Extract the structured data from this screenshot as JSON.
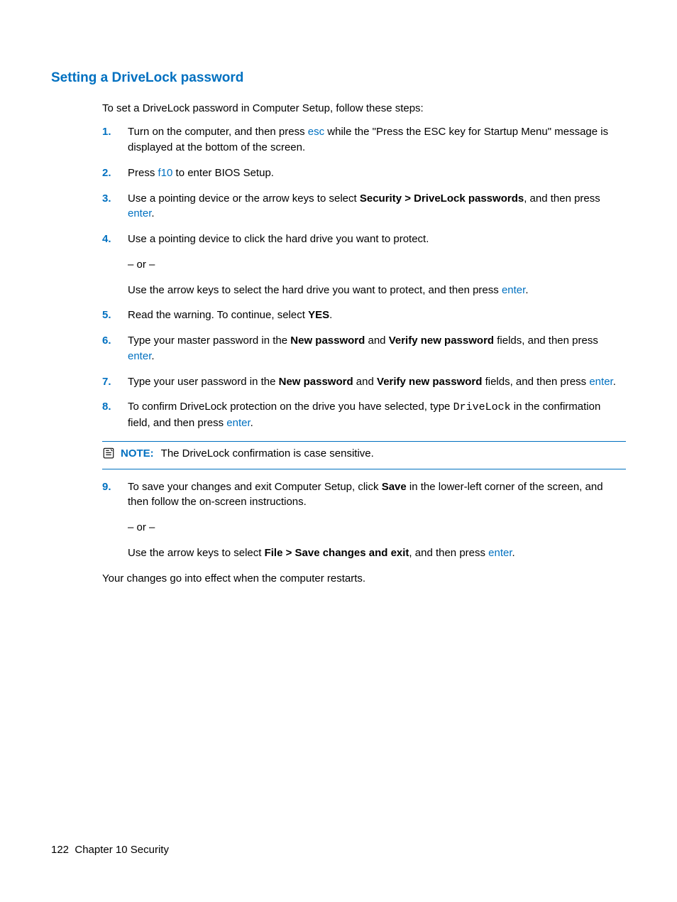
{
  "heading": "Setting a DriveLock password",
  "intro": "To set a DriveLock password in Computer Setup, follow these steps:",
  "steps": {
    "s1": {
      "num": "1.",
      "a": "Turn on the computer, and then press ",
      "key": "esc",
      "b": " while the \"Press the ESC key for Startup Menu\" message is displayed at the bottom of the screen."
    },
    "s2": {
      "num": "2.",
      "a": "Press ",
      "key": "f10",
      "b": " to enter BIOS Setup."
    },
    "s3": {
      "num": "3.",
      "a": "Use a pointing device or the arrow keys to select ",
      "bold": "Security > DriveLock passwords",
      "b": ", and then press ",
      "key": "enter",
      "c": "."
    },
    "s4": {
      "num": "4.",
      "a": "Use a pointing device to click the hard drive you want to protect.",
      "or": "– or –",
      "b": "Use the arrow keys to select the hard drive you want to protect, and then press ",
      "key": "enter",
      "c": "."
    },
    "s5": {
      "num": "5.",
      "a": "Read the warning. To continue, select ",
      "bold": "YES",
      "b": "."
    },
    "s6": {
      "num": "6.",
      "a": "Type your master password in the ",
      "bold1": "New password",
      "b": " and ",
      "bold2": "Verify new password",
      "c": " fields, and then press ",
      "key": "enter",
      "d": "."
    },
    "s7": {
      "num": "7.",
      "a": "Type your user password in the ",
      "bold1": "New password",
      "b": " and ",
      "bold2": "Verify new password",
      "c": " fields, and then press ",
      "key": "enter",
      "d": "."
    },
    "s8": {
      "num": "8.",
      "a": "To confirm DriveLock protection on the drive you have selected, type ",
      "mono": "DriveLock",
      "b": " in the confirmation field, and then press ",
      "key": "enter",
      "c": "."
    },
    "s9": {
      "num": "9.",
      "a": "To save your changes and exit Computer Setup, click ",
      "bold1": "Save",
      "b": " in the lower-left corner of the screen, and then follow the on-screen instructions.",
      "or": "– or –",
      "c": "Use the arrow keys to select ",
      "bold2": "File > Save changes and exit",
      "d": ", and then press ",
      "key": "enter",
      "e": "."
    }
  },
  "note": {
    "label": "NOTE:",
    "text": "The DriveLock confirmation is case sensitive."
  },
  "closing": "Your changes go into effect when the computer restarts.",
  "footer": {
    "page": "122",
    "chapter": "Chapter 10   Security"
  }
}
